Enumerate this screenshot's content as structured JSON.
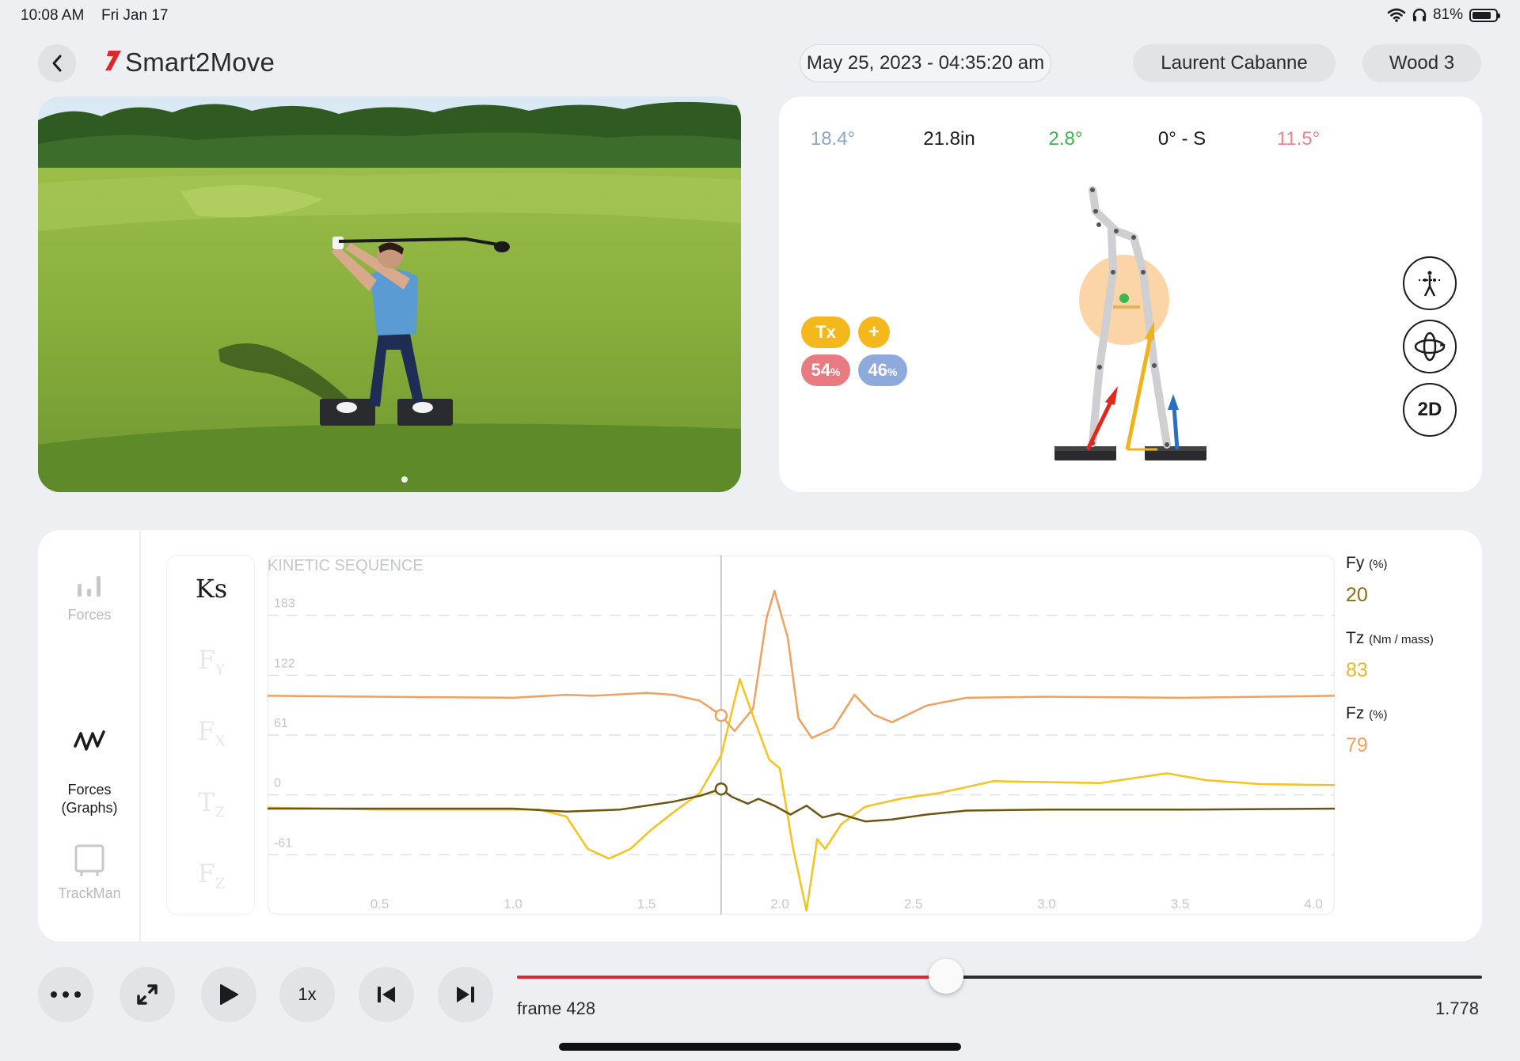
{
  "status_bar": {
    "time": "10:08 AM",
    "date": "Fri Jan 17",
    "battery": "81%"
  },
  "header": {
    "logo_text": "Smart2Move",
    "session_date": "May 25, 2023 - 04:35:20 am",
    "player": "Laurent Cabanne",
    "club": "Wood 3"
  },
  "metrics": [
    {
      "value": "18.4°",
      "color": "#8aa6c8"
    },
    {
      "value": "21.8in",
      "color": "#1c1c1e"
    },
    {
      "value": "2.8°",
      "color": "#3db54a"
    },
    {
      "value": "0° - S",
      "color": "#1c1c1e"
    },
    {
      "value": "11.5°",
      "color": "#e8858a"
    }
  ],
  "model_view": {
    "badge_tx": "Tx",
    "badge_plus": "+",
    "weight_left": "54",
    "weight_right": "46",
    "weight_unit": "%",
    "view_button": "2D"
  },
  "side_nav": [
    {
      "label": "Forces",
      "icon": "bar-chart-icon",
      "active": false
    },
    {
      "label": "Forces\n(Graphs)",
      "icon": "wave-icon",
      "active": true
    },
    {
      "label": "TrackMan",
      "icon": "trackman-icon",
      "active": false
    }
  ],
  "graph_selectors": [
    {
      "label": "Ks",
      "sub": "",
      "active": true
    },
    {
      "label": "F",
      "sub": "Y",
      "active": false
    },
    {
      "label": "F",
      "sub": "X",
      "active": false
    },
    {
      "label": "T",
      "sub": "Z",
      "active": false
    },
    {
      "label": "F",
      "sub": "Z",
      "active": false
    }
  ],
  "chart_data": {
    "type": "line",
    "title": "KINETIC SEQUENCE",
    "y_ticks": [
      "183",
      "122",
      "61",
      "0",
      "-61"
    ],
    "x_ticks": [
      "0.5",
      "1.0",
      "1.5",
      "2.0",
      "2.5",
      "3.0",
      "3.5",
      "4.0"
    ],
    "xlim": [
      0.08,
      4.08
    ],
    "ylim": [
      -122,
      244
    ],
    "cursor_x": 1.78,
    "grid": "dashed horizontal",
    "series": [
      {
        "color": "#f0a060",
        "points": [
          [
            0.08,
            101
          ],
          [
            0.5,
            100
          ],
          [
            1.0,
            99
          ],
          [
            1.2,
            102
          ],
          [
            1.3,
            101
          ],
          [
            1.5,
            104
          ],
          [
            1.6,
            102
          ],
          [
            1.7,
            96
          ],
          [
            1.78,
            81
          ],
          [
            1.83,
            65
          ],
          [
            1.9,
            88
          ],
          [
            1.95,
            180
          ],
          [
            1.98,
            208
          ],
          [
            2.03,
            160
          ],
          [
            2.07,
            78
          ],
          [
            2.12,
            58
          ],
          [
            2.2,
            68
          ],
          [
            2.28,
            102
          ],
          [
            2.35,
            82
          ],
          [
            2.42,
            74
          ],
          [
            2.55,
            91
          ],
          [
            2.7,
            99
          ],
          [
            3.0,
            100
          ],
          [
            3.5,
            99
          ],
          [
            4.08,
            101
          ]
        ]
      },
      {
        "color": "#f5c21e",
        "points": [
          [
            0.08,
            -13
          ],
          [
            0.5,
            -15
          ],
          [
            1.0,
            -15
          ],
          [
            1.1,
            -15
          ],
          [
            1.2,
            -22
          ],
          [
            1.28,
            -55
          ],
          [
            1.36,
            -65
          ],
          [
            1.44,
            -55
          ],
          [
            1.52,
            -35
          ],
          [
            1.6,
            -18
          ],
          [
            1.7,
            2
          ],
          [
            1.78,
            40
          ],
          [
            1.85,
            118
          ],
          [
            1.9,
            80
          ],
          [
            1.96,
            36
          ],
          [
            2.0,
            27
          ],
          [
            2.05,
            -55
          ],
          [
            2.07,
            -80
          ],
          [
            2.1,
            -118
          ],
          [
            2.14,
            -45
          ],
          [
            2.17,
            -55
          ],
          [
            2.23,
            -30
          ],
          [
            2.32,
            -12
          ],
          [
            2.45,
            -4
          ],
          [
            2.6,
            2
          ],
          [
            2.8,
            14
          ],
          [
            3.0,
            13
          ],
          [
            3.2,
            12
          ],
          [
            3.35,
            18
          ],
          [
            3.45,
            22
          ],
          [
            3.6,
            15
          ],
          [
            3.8,
            11
          ],
          [
            4.08,
            10
          ]
        ]
      },
      {
        "color": "#6b5510",
        "points": [
          [
            0.08,
            -14
          ],
          [
            0.5,
            -14
          ],
          [
            1.0,
            -14
          ],
          [
            1.2,
            -17
          ],
          [
            1.4,
            -15
          ],
          [
            1.6,
            -7
          ],
          [
            1.7,
            -1
          ],
          [
            1.78,
            6
          ],
          [
            1.82,
            -2
          ],
          [
            1.88,
            -9
          ],
          [
            1.92,
            -4
          ],
          [
            1.98,
            -11
          ],
          [
            2.04,
            -20
          ],
          [
            2.1,
            -11
          ],
          [
            2.16,
            -23
          ],
          [
            2.22,
            -19
          ],
          [
            2.32,
            -27
          ],
          [
            2.42,
            -25
          ],
          [
            2.55,
            -20
          ],
          [
            2.7,
            -16
          ],
          [
            3.0,
            -15
          ],
          [
            3.5,
            -15
          ],
          [
            4.08,
            -14
          ]
        ]
      }
    ]
  },
  "legend": [
    {
      "name": "Fy",
      "unit": "(%)",
      "value": "20",
      "color": "#8a6e0f"
    },
    {
      "name": "Tz",
      "unit": "(Nm / mass)",
      "value": "83",
      "color": "#e8b62a"
    },
    {
      "name": "Fz",
      "unit": "(%)",
      "value": "79",
      "color": "#f0a060"
    }
  ],
  "playback": {
    "speed": "1x",
    "frame": "frame 428",
    "time": "1.778",
    "progress": 0.445
  }
}
